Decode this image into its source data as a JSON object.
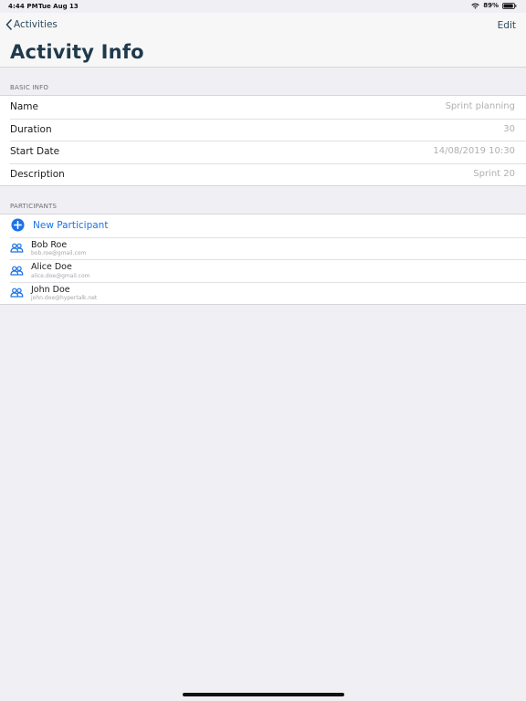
{
  "status_bar": {
    "time": "4:44 PM",
    "date": "Tue Aug 13",
    "battery_percent": "89%",
    "battery_level": 0.89
  },
  "nav": {
    "back_label": "Activities",
    "edit_label": "Edit",
    "title": "Activity Info"
  },
  "basic_info": {
    "header": "BASIC INFO",
    "rows": [
      {
        "label": "Name",
        "value": "Sprint planning"
      },
      {
        "label": "Duration",
        "value": "30"
      },
      {
        "label": "Start Date",
        "value": "14/08/2019 10:30"
      },
      {
        "label": "Description",
        "value": "Sprint 20"
      }
    ]
  },
  "participants": {
    "header": "PARTICIPANTS",
    "new_label": "New Participant",
    "items": [
      {
        "name": "Bob Roe",
        "email": "bob.roe@gmail.com"
      },
      {
        "name": "Alice Doe",
        "email": "alice.doe@gmail.com"
      },
      {
        "name": "John Doe",
        "email": "john.doe@hypertalk.net"
      }
    ]
  },
  "colors": {
    "accent": "#1a73e8",
    "title": "#1f3a4c",
    "background": "#efeff4"
  }
}
